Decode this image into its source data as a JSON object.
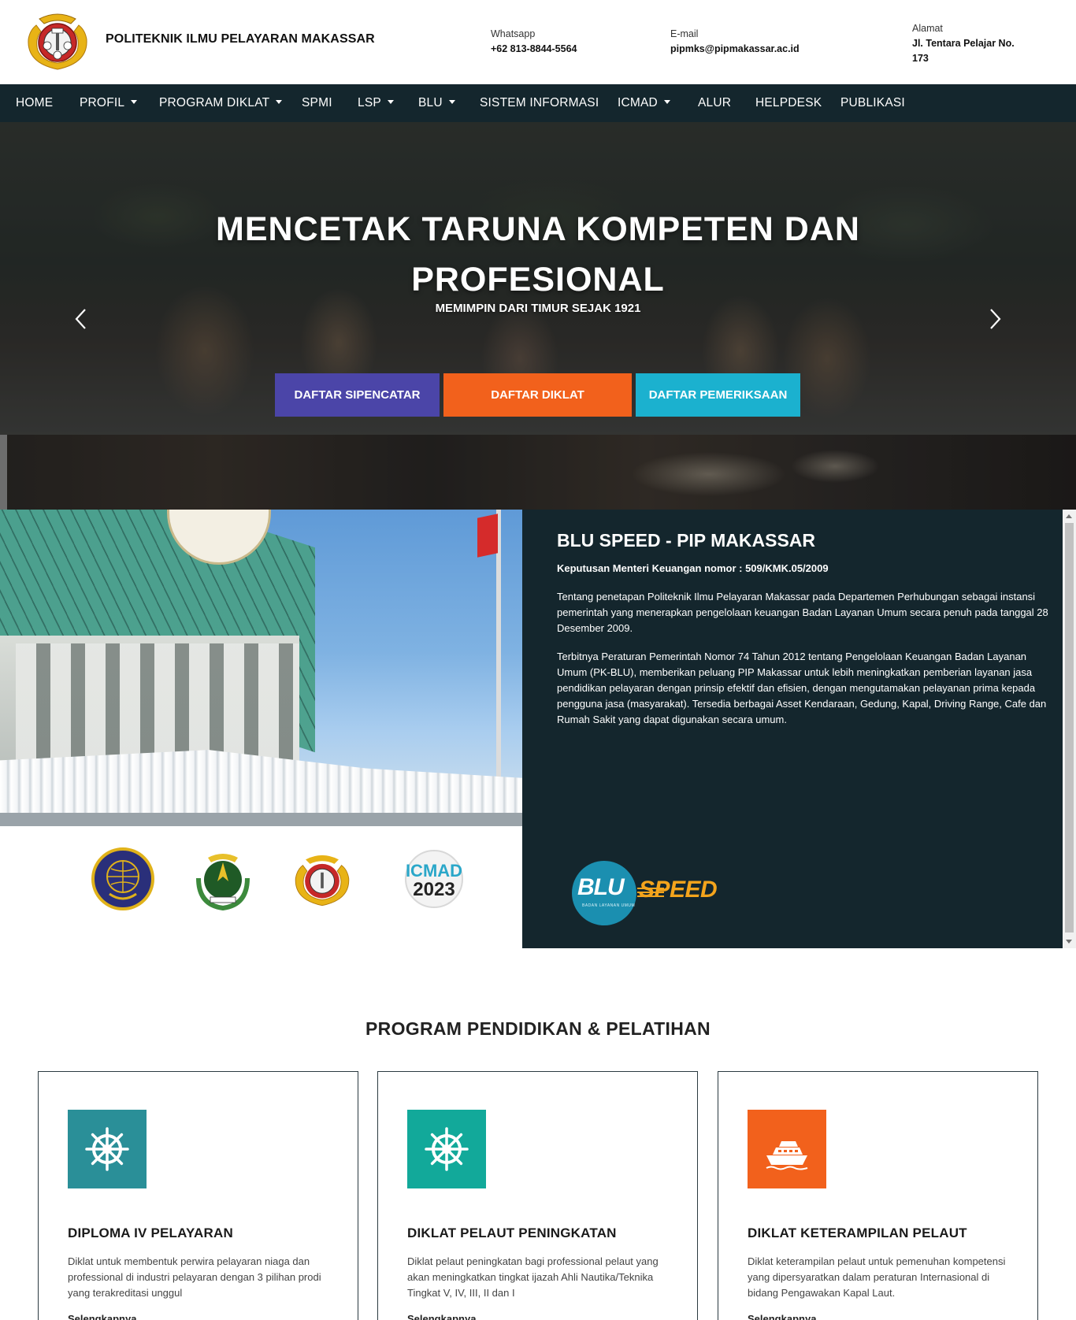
{
  "header": {
    "brand": "POLITEKNIK ILMU PELAYARAN MAKASSAR",
    "whatsapp_label": "Whatsapp",
    "whatsapp_value": "+62 813-8844-5564",
    "email_label": "E-mail",
    "email_value": "pipmks@pipmakassar.ac.id",
    "address_label": "Alamat",
    "address_value": "Jl. Tentara Pelajar No. 173"
  },
  "nav": {
    "items": [
      {
        "label": "HOME"
      },
      {
        "label": "PROFIL"
      },
      {
        "label": "PROGRAM DIKLAT"
      },
      {
        "label": "SPMI"
      },
      {
        "label": "LSP"
      },
      {
        "label": "BLU"
      },
      {
        "label": "SISTEM INFORMASI"
      },
      {
        "label": "ICMAD"
      },
      {
        "label": "ALUR"
      },
      {
        "label": "HELPDESK"
      },
      {
        "label": "PUBLIKASI"
      }
    ]
  },
  "hero": {
    "title": "MENCETAK TARUNA KOMPETEN DAN PROFESIONAL",
    "subtitle": "MEMIMPIN DARI TIMUR SEJAK 1921",
    "buttons": [
      {
        "label": "DAFTAR SIPENCATAR",
        "color": "#4b45a8"
      },
      {
        "label": "DAFTAR DIKLAT",
        "color": "#f2611c"
      },
      {
        "label": "DAFTAR PEMERIKSAAN",
        "color": "#1bb1cf"
      }
    ]
  },
  "blu": {
    "title": "BLU SPEED - PIP MAKASSAR",
    "decree": "Keputusan Menteri Keuangan nomor : 509/KMK.05/2009",
    "paragraph1": "Tentang penetapan Politeknik Ilmu Pelayaran Makassar pada Departemen Perhubungan sebagai instansi pemerintah yang menerapkan pengelolaan keuangan Badan Layanan Umum secara penuh pada tanggal 28 Desember 2009.",
    "paragraph2": "Terbitnya Peraturan Pemerintah Nomor 74 Tahun 2012 tentang Pengelolaan Keuangan Badan Layanan Umum (PK-BLU), memberikan peluang PIP Makassar untuk lebih meningkatkan pemberian layanan jasa pendidikan pelayaran dengan prinsip efektif dan efisien, dengan mengutamakan pelayanan prima kepada pengguna jasa (masyarakat). Tersedia berbagai Asset Kendaraan, Gedung, Kapal, Driving Range, Cafe dan Rumah Sakit yang dapat digunakan secara umum.",
    "logo_blu": "BLU",
    "logo_blu_small": "BADAN LAYANAN UMUM",
    "logo_speed": "SPEED",
    "bg_color": "#14262d"
  },
  "partner_logos": [
    {
      "icon": "kemenhub-logo-icon"
    },
    {
      "icon": "bppsdm-logo-icon"
    },
    {
      "icon": "pip-makassar-logo-icon"
    },
    {
      "icon": "icmad-2023-logo-icon",
      "text_top": "ICMAD",
      "text_bottom": "2023"
    }
  ],
  "programs": {
    "title": "PROGRAM PENDIDIKAN & PELATIHAN",
    "cards": [
      {
        "title": "DIPLOMA IV PELAYARAN",
        "description": "Diklat untuk membentuk perwira pelayaran niaga dan professional di industri pelayaran dengan 3 pilihan prodi yang terakreditasi unggul",
        "link": "Selengkapnya",
        "icon": "ship-wheel-icon",
        "color": "#2a8f98"
      },
      {
        "title": "DIKLAT PELAUT PENINGKATAN",
        "description": "Diklat pelaut peningkatan bagi professional pelaut yang akan meningkatkan tingkat ijazah Ahli Nautika/Teknika Tingkat V, IV, III, II dan I",
        "link": "Selengkapnya",
        "icon": "ship-wheel-icon",
        "color": "#12a99a"
      },
      {
        "title": "DIKLAT KETERAMPILAN PELAUT",
        "description": "Diklat keterampilan pelaut untuk pemenuhan kompetensi yang dipersyaratkan dalam peraturan Internasional di bidang Pengawakan Kapal Laut.",
        "link": "Selengkapnya",
        "icon": "cruise-ship-icon",
        "color": "#f2611c"
      }
    ]
  }
}
